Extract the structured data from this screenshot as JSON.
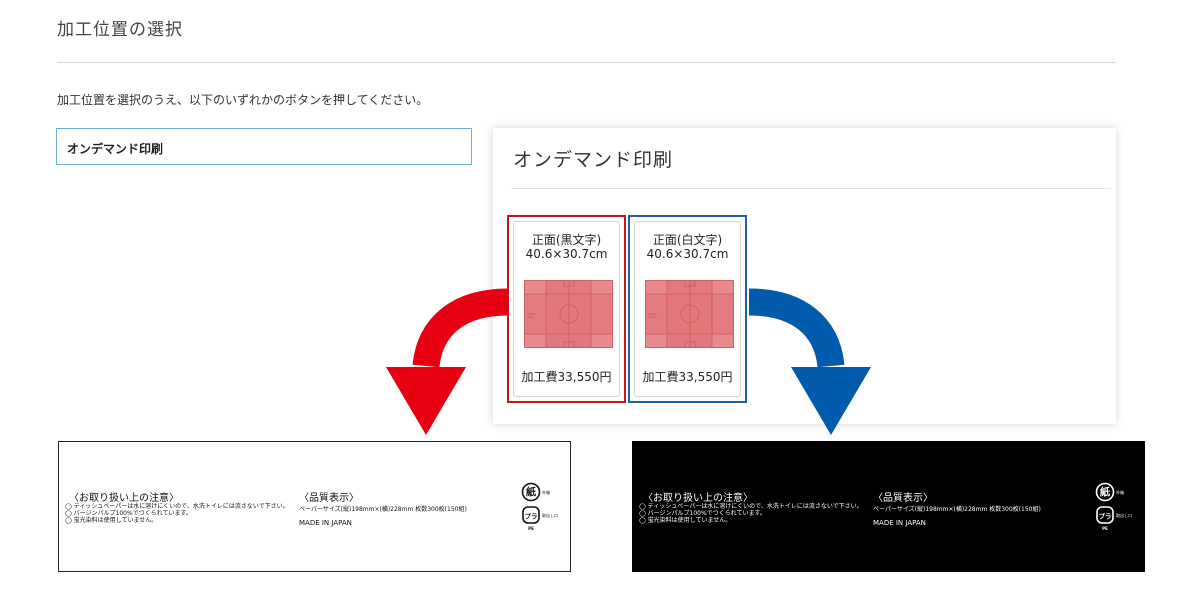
{
  "page": {
    "title": "加工位置の選択",
    "instruction": "加工位置を選択のうえ、以下のいずれかのボタンを押してください。"
  },
  "method_button": {
    "label": "オンデマンド印刷"
  },
  "panel": {
    "title": "オンデマンド印刷",
    "options": [
      {
        "name": "正面(黒文字)",
        "size": "40.6×30.7cm",
        "price": "加工費33,550円",
        "border_color": "#c8151d"
      },
      {
        "name": "正面(白文字)",
        "size": "40.6×30.7cm",
        "price": "加工費33,550円",
        "border_color": "#1f5ea8"
      }
    ]
  },
  "arrows": {
    "left_color": "#e60012",
    "right_color": "#005bac"
  },
  "label_samples": [
    {
      "variant": "black-text",
      "care_heading": "〈お取り扱い上の注意〉",
      "care_items": [
        "◯ ティッシュペーパーは水に溶けにくいので、水洗トイレには流さないで下さい。",
        "◯ バージンパルプ100%でつくられています。",
        "◯ 蛍光染料は使用していません。"
      ],
      "quality_heading": "〈品質表示〉",
      "quality_size": "ペーパーサイズ(縦)198mm×(横)228mm 枚数300枚(150組)",
      "quality_origin": "MADE IN JAPAN",
      "mark_paper": {
        "glyph": "紙",
        "caption": "外箱"
      },
      "mark_plastic": {
        "glyph": "プラ",
        "caption": "取出し口",
        "material": "PE"
      }
    },
    {
      "variant": "white-text",
      "care_heading": "〈お取り扱い上の注意〉",
      "care_items": [
        "◯ ティッシュペーパーは水に溶けにくいので、水洗トイレには流さないで下さい。",
        "◯ バージンパルプ100%でつくられています。",
        "◯ 蛍光染料は使用していません。"
      ],
      "quality_heading": "〈品質表示〉",
      "quality_size": "ペーパーサイズ(縦)198mm×(横)228mm 枚数300枚(150組)",
      "quality_origin": "MADE IN JAPAN",
      "mark_paper": {
        "glyph": "紙",
        "caption": "外箱"
      },
      "mark_plastic": {
        "glyph": "プラ",
        "caption": "取出し口",
        "material": "PE"
      }
    }
  ]
}
